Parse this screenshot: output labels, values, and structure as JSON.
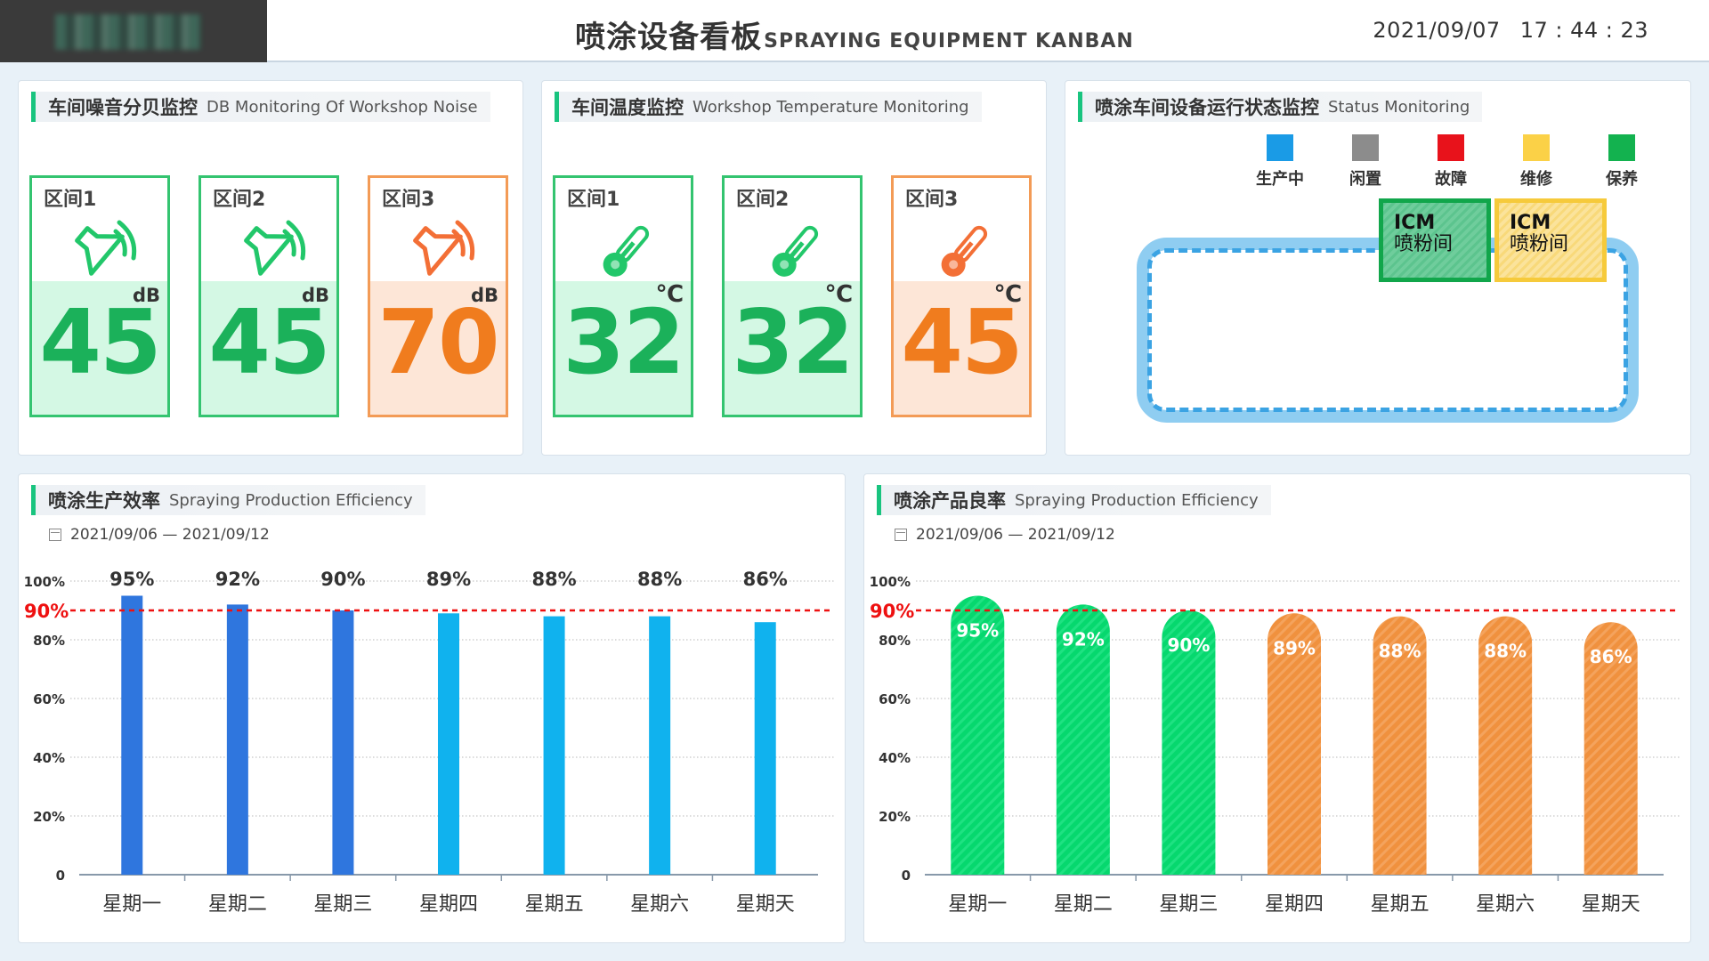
{
  "header": {
    "title_cn": "喷涂设备看板",
    "title_en": "SPRAYING EQUIPMENT KANBAN",
    "date": "2021/09/07",
    "time": "17 : 44 : 23"
  },
  "noise": {
    "title_cn": "车间噪音分贝监控",
    "title_en": "DB Monitoring Of Workshop Noise",
    "zones": [
      {
        "label": "区间1",
        "value": "45",
        "unit": "dB",
        "status": "green",
        "icon": "speaker-icon"
      },
      {
        "label": "区间2",
        "value": "45",
        "unit": "dB",
        "status": "green",
        "icon": "speaker-icon"
      },
      {
        "label": "区间3",
        "value": "70",
        "unit": "dB",
        "status": "orange",
        "icon": "speaker-icon"
      }
    ]
  },
  "temperature": {
    "title_cn": "车间温度监控",
    "title_en": "Workshop Temperature Monitoring",
    "zones": [
      {
        "label": "区间1",
        "value": "32",
        "unit": "℃",
        "status": "green",
        "icon": "thermometer-icon"
      },
      {
        "label": "区间2",
        "value": "32",
        "unit": "℃",
        "status": "green",
        "icon": "thermometer-icon"
      },
      {
        "label": "区间3",
        "value": "45",
        "unit": "℃",
        "status": "orange",
        "icon": "thermometer-icon"
      }
    ]
  },
  "status": {
    "title_cn": "喷涂车间设备运行状态监控",
    "title_en": "Status Monitoring",
    "legend": [
      {
        "label": "生产中",
        "color": "#1a9be6"
      },
      {
        "label": "闲置",
        "color": "#8c8c8c"
      },
      {
        "label": "故障",
        "color": "#e8121b"
      },
      {
        "label": "维修",
        "color": "#fbd147"
      },
      {
        "label": "保养",
        "color": "#13b24f"
      }
    ],
    "stations": [
      {
        "line1": "ICM",
        "line2": "喷粉间",
        "state": "保养"
      },
      {
        "line1": "ICM",
        "line2": "喷粉间",
        "state": "维修"
      }
    ]
  },
  "colors": {
    "green": "#1bb15a",
    "orange": "#f07c1e",
    "blue_dark": "#2f76de",
    "blue_light": "#10b2ee",
    "bar_green": "#06d86e",
    "bar_orange": "#f0913e",
    "threshold": "#ee1111"
  },
  "chart_data": [
    {
      "type": "bar",
      "title": "喷涂生产效率",
      "title_en": "Spraying Production Efficiency",
      "date_range": "2021/09/06 — 2021/09/12",
      "categories": [
        "星期一",
        "星期二",
        "星期三",
        "星期四",
        "星期五",
        "星期六",
        "星期天"
      ],
      "values": [
        95,
        92,
        90,
        89,
        88,
        88,
        86
      ],
      "value_labels": [
        "95%",
        "92%",
        "90%",
        "89%",
        "88%",
        "88%",
        "86%"
      ],
      "y_ticks": [
        "0",
        "20%",
        "40%",
        "60%",
        "80%",
        "100%"
      ],
      "ylim": [
        0,
        100
      ],
      "threshold": 90,
      "threshold_label": "90%",
      "grid": true
    },
    {
      "type": "bar",
      "title": "喷涂产品良率",
      "title_en": "Spraying Production Efficiency",
      "date_range": "2021/09/06 — 2021/09/12",
      "categories": [
        "星期一",
        "星期二",
        "星期三",
        "星期四",
        "星期五",
        "星期六",
        "星期天"
      ],
      "values": [
        95,
        92,
        90,
        89,
        88,
        88,
        86
      ],
      "value_labels": [
        "95%",
        "92%",
        "90%",
        "89%",
        "88%",
        "88%",
        "86%"
      ],
      "y_ticks": [
        "0",
        "20%",
        "40%",
        "60%",
        "80%",
        "100%"
      ],
      "ylim": [
        0,
        100
      ],
      "threshold": 90,
      "threshold_label": "90%",
      "grid": true
    }
  ]
}
